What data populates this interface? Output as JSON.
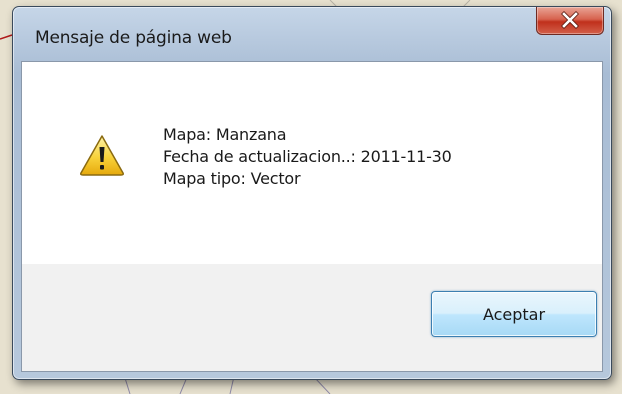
{
  "dialog": {
    "title": "Mensaje de página web",
    "close_icon": "close-icon",
    "message_icon": "warning-icon",
    "message_lines": [
      "Mapa: Manzana",
      "Fecha de actualizacion..: 2011-11-30",
      "Mapa tipo: Vector"
    ],
    "ok_label": "Aceptar"
  },
  "colors": {
    "title_bar": "#b7c9de",
    "close_button": "#c0301c",
    "ok_button": "#bee6fd",
    "footer": "#f1f1f1",
    "background": "#e7e1cf"
  }
}
